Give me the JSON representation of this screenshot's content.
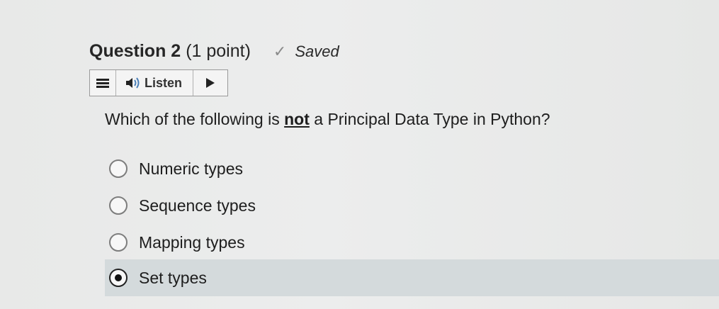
{
  "question": {
    "title": "Question 2",
    "points": "(1 point)",
    "status": "Saved",
    "status_icon": "checkmark-icon"
  },
  "listen_bar": {
    "listen_label": "Listen",
    "menu_icon": "menu-icon",
    "speaker_icon": "speaker-icon",
    "play_icon": "play-icon"
  },
  "prompt": {
    "before": "Which of the following is ",
    "emphasis": "not",
    "after": " a Principal Data Type in Python?"
  },
  "options": [
    {
      "label": "Numeric types",
      "selected": false
    },
    {
      "label": "Sequence types",
      "selected": false
    },
    {
      "label": "Mapping types",
      "selected": false
    },
    {
      "label": "Set types",
      "selected": true
    }
  ],
  "colors": {
    "selected_row": "#d4dadc",
    "background": "#e9eaea"
  }
}
